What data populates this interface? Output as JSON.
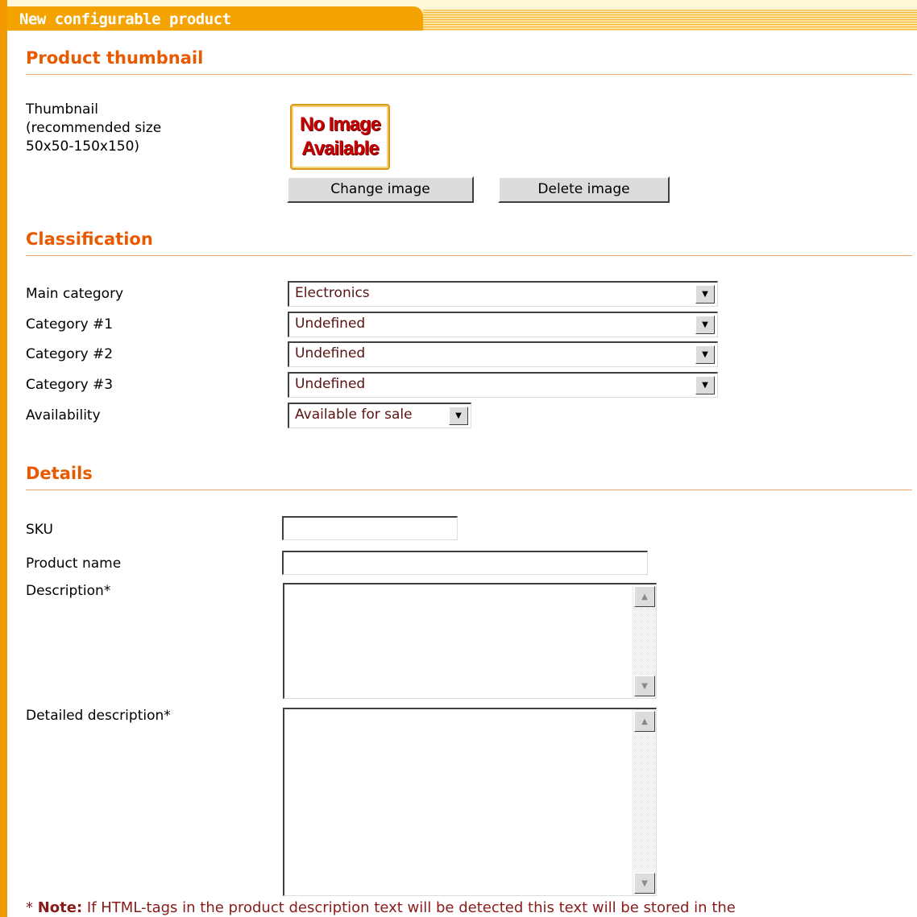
{
  "header": {
    "title": "New configurable product"
  },
  "sections": {
    "thumbnail": {
      "title": "Product thumbnail"
    },
    "classification": {
      "title": "Classification"
    },
    "details": {
      "title": "Details"
    }
  },
  "thumbnail": {
    "label_line1": "Thumbnail",
    "label_line2": "(recommended size",
    "label_line3": "50x50-150x150)",
    "placeholder_line1": "No Image",
    "placeholder_line2": "Available",
    "change_button": "Change image",
    "delete_button": "Delete image"
  },
  "classification": {
    "main_category": {
      "label": "Main category",
      "value": "Electronics"
    },
    "category1": {
      "label": "Category #1",
      "value": "Undefined"
    },
    "category2": {
      "label": "Category #2",
      "value": "Undefined"
    },
    "category3": {
      "label": "Category #3",
      "value": "Undefined"
    },
    "availability": {
      "label": "Availability",
      "value": "Available for sale"
    }
  },
  "details": {
    "sku": {
      "label": "SKU",
      "value": ""
    },
    "product_name": {
      "label": "Product name",
      "value": ""
    },
    "description": {
      "label": "Description*",
      "value": ""
    },
    "detailed_description": {
      "label": "Detailed description*",
      "value": ""
    }
  },
  "note": {
    "prefix": "* ",
    "bold": "Note:",
    "text": " If HTML-tags in the product description text will be detected this text will be stored in the"
  },
  "colors": {
    "accent_orange": "#f29a00",
    "section_title": "#e85a00",
    "note_text": "#8b1a1a"
  }
}
